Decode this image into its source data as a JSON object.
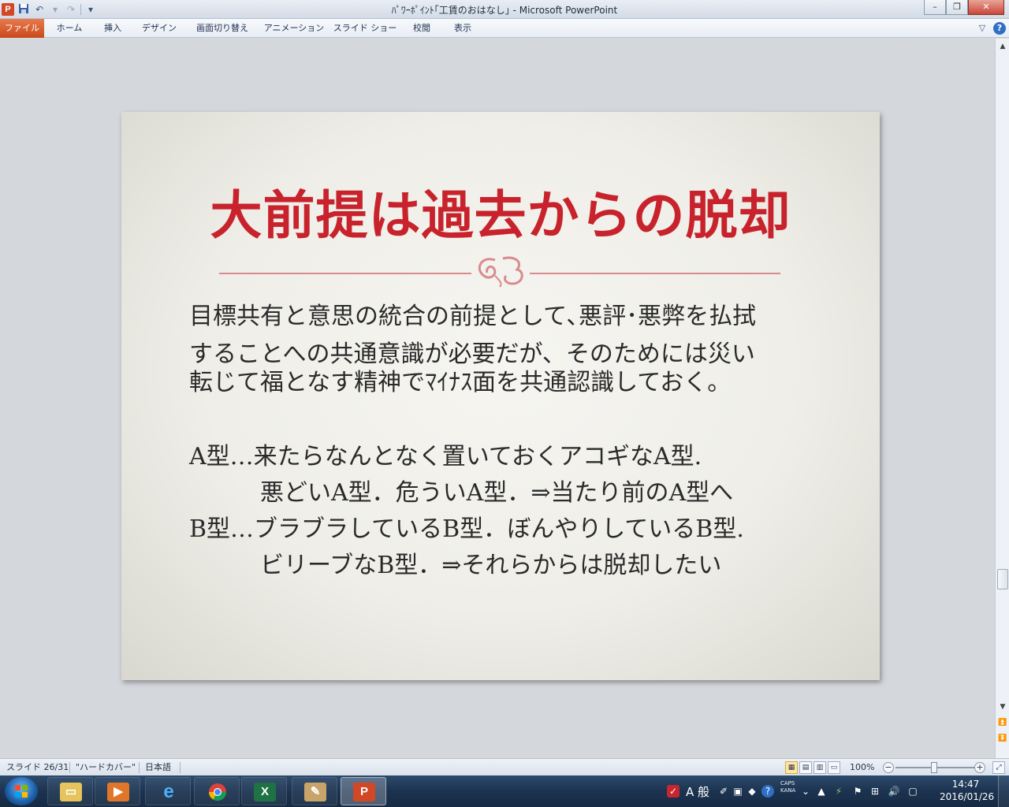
{
  "window": {
    "title": "ﾊﾟﾜｰﾎﾟｲﾝﾄ｢工賃のおはなし｣ - Microsoft PowerPoint",
    "app_icon_letter": "P",
    "controls": {
      "minimize": "–",
      "restore": "❐",
      "close": "✕"
    }
  },
  "ribbon": {
    "tabs": [
      "ファイル",
      "ホーム",
      "挿入",
      "デザイン",
      "画面切り替え",
      "アニメーション",
      "スライド ショー",
      "校閲",
      "表示"
    ]
  },
  "slide": {
    "title": "大前提は過去からの脱却",
    "paragraph": [
      "目標共有と意思の統合の前提として､悪評･悪弊を払拭",
      "することへの共通意識が必要だが、そのためには災い",
      "転じて福となす精神でﾏｲﾅｽ面を共通認識しておく。"
    ],
    "types": [
      "A型…来たらなんとなく置いておくアコギなA型.",
      "　　　悪どいA型．危ういA型．⇒当たり前のA型へ",
      "B型…ブラブラしているB型．ぼんやりしているB型.",
      "　　　ビリーブなB型．⇒それらからは脱却したい"
    ],
    "colors": {
      "title": "#c8232c",
      "divider": "#d98b8e",
      "body": "#2a2a2a"
    }
  },
  "status": {
    "slide": "スライド 26/31",
    "theme": "\"ハードカバー\"",
    "language": "日本語",
    "zoom": "100%"
  },
  "taskbar": {
    "ime": "A 般",
    "caps": "CAPS",
    "kana": "KANA",
    "time": "14:47",
    "date": "2016/01/26"
  }
}
